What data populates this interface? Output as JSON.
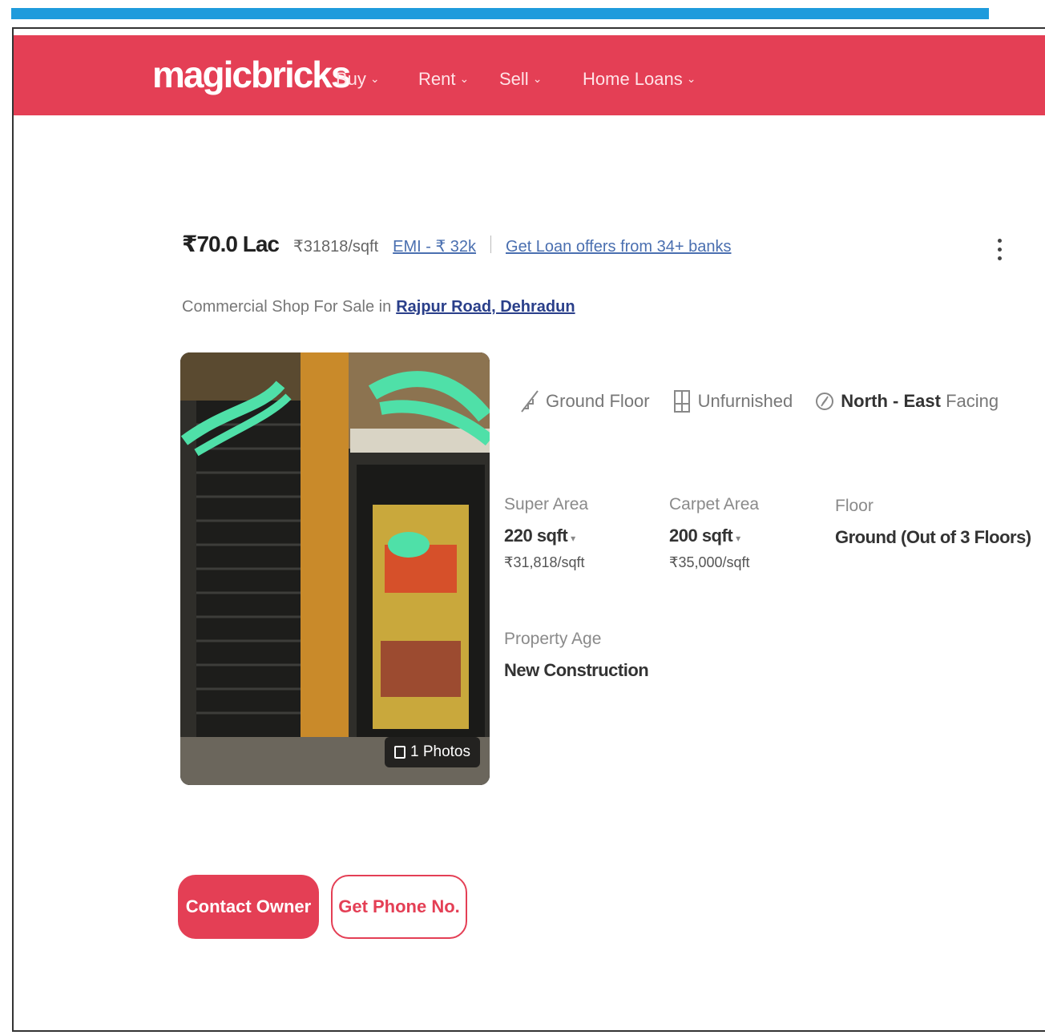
{
  "brand": {
    "logo": "magicbricks",
    "color": "#e43f55"
  },
  "nav": {
    "items": [
      {
        "label": "Buy"
      },
      {
        "label": "Rent"
      },
      {
        "label": "Sell"
      },
      {
        "label": "Home Loans"
      }
    ]
  },
  "listing": {
    "price": "₹70.0 Lac",
    "rate": "₹31818/sqft",
    "emi": "EMI - ₹ 32k",
    "loan_offer": "Get Loan offers from 34+ banks",
    "subtitle_prefix": "Commercial Shop For Sale in",
    "location": "Rajpur Road, Dehradun",
    "photos_label": "1 Photos",
    "tags": {
      "floor": "Ground Floor",
      "furnishing": "Unfurnished",
      "facing_bold": "North - East",
      "facing_suffix": "Facing"
    },
    "specs": {
      "super_area": {
        "label": "Super Area",
        "value": "220 sqft",
        "rate": "₹31,818/sqft"
      },
      "carpet_area": {
        "label": "Carpet Area",
        "value": "200 sqft",
        "rate": "₹35,000/sqft"
      },
      "floor": {
        "label": "Floor",
        "value": "Ground (Out of 3 Floors)"
      },
      "property_age": {
        "label": "Property Age",
        "value": "New Construction"
      }
    }
  },
  "actions": {
    "contact_owner": "Contact Owner",
    "get_phone": "Get Phone No."
  }
}
